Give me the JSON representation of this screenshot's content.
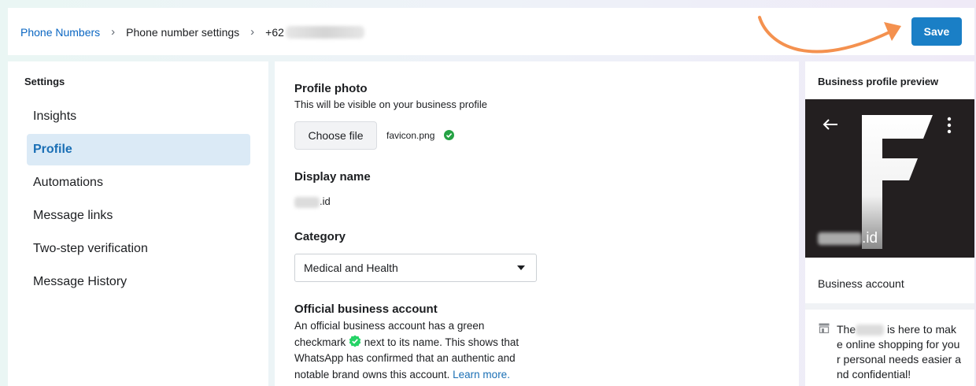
{
  "breadcrumb": {
    "phone_numbers": "Phone Numbers",
    "settings": "Phone number settings",
    "number_prefix": "+62"
  },
  "toolbar": {
    "save_label": "Save"
  },
  "sidebar": {
    "heading": "Settings",
    "items": [
      {
        "label": "Insights",
        "active": false
      },
      {
        "label": "Profile",
        "active": true
      },
      {
        "label": "Automations",
        "active": false
      },
      {
        "label": "Message links",
        "active": false
      },
      {
        "label": "Two-step verification",
        "active": false
      },
      {
        "label": "Message History",
        "active": false
      }
    ]
  },
  "profile_photo": {
    "title": "Profile photo",
    "subtitle": "This will be visible on your business profile",
    "choose_label": "Choose file",
    "file_name": "favicon.png"
  },
  "display_name": {
    "title": "Display name",
    "value_suffix": ".id"
  },
  "category": {
    "title": "Category",
    "selected": "Medical and Health"
  },
  "official": {
    "title": "Official business account",
    "line1": "An official business account has a green",
    "line2a": "checkmark",
    "line2b": "next to its name. This shows that",
    "line3": "WhatsApp has confirmed that an authentic and",
    "line4": "notable brand owns this account.",
    "learn_more": "Learn more."
  },
  "preview": {
    "heading": "Business profile preview",
    "logo_letter": "F",
    "name_suffix": ".id",
    "account_type": "Business account",
    "about_prefix": "The",
    "about_line1": "is here to mak",
    "about_line2": "e online shopping for you",
    "about_line3": "r personal needs easier a",
    "about_line4": "nd confidential!"
  },
  "colors": {
    "accent": "#1a7fc6",
    "active_nav_bg": "#dbeaf6",
    "verified_green": "#25d366",
    "annotation_arrow": "#f4914f"
  }
}
